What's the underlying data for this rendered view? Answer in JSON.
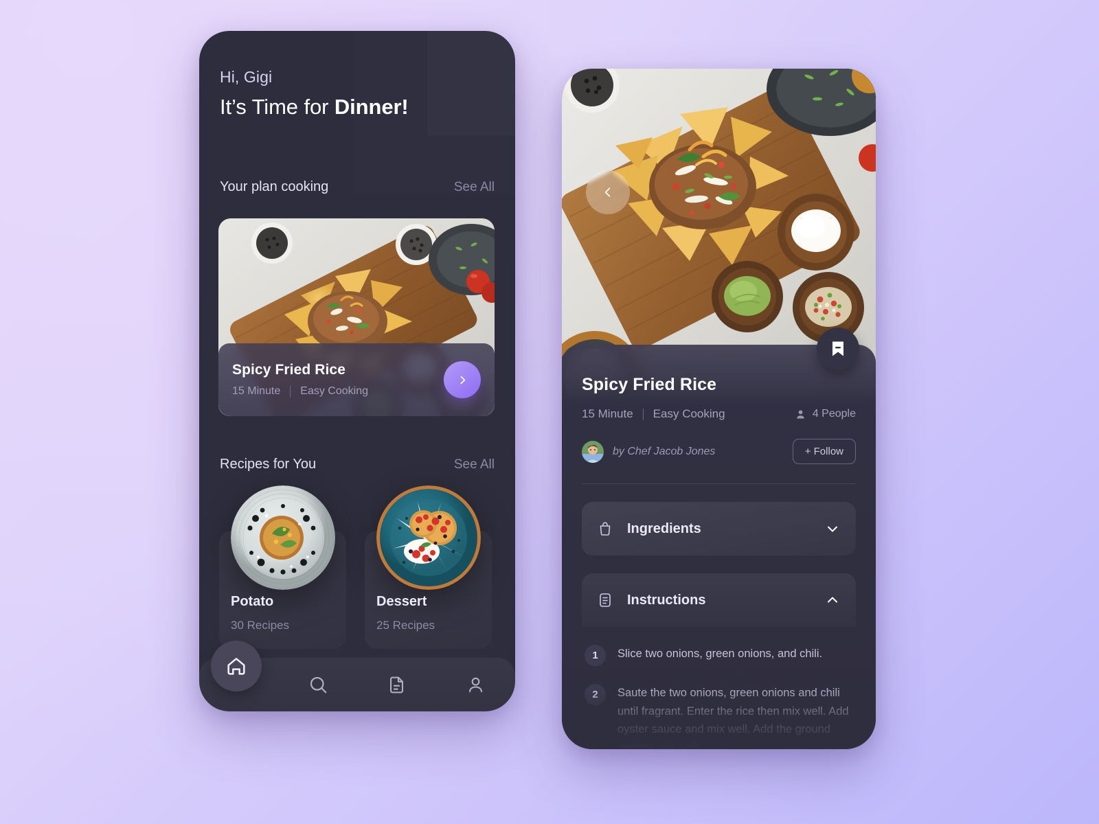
{
  "theme": {
    "bg_light": "#e3d5fa",
    "bg_deep": "#bcb7fb",
    "panel": "#2e2d3d",
    "accent_purple": "#8f6cf2",
    "accent_purple_light": "#b39af8",
    "text_primary": "#ffffff",
    "text_muted": "#8e89a3"
  },
  "home": {
    "greeting": "Hi, Gigi",
    "headline_prefix": "It’s Time for ",
    "headline_bold": "Dinner!",
    "plan_section": {
      "title": "Your plan cooking",
      "see_all": "See All"
    },
    "plan_card": {
      "name": "Spicy Fried Rice",
      "time": "15 Minute",
      "difficulty": "Easy Cooking",
      "go_icon": "chevron-right-icon"
    },
    "recipes_section": {
      "title": "Recipes for You",
      "see_all": "See All"
    },
    "recipes": [
      {
        "title": "Potato",
        "count": "30 Recipes"
      },
      {
        "title": "Dessert",
        "count": "25 Recipes"
      }
    ],
    "nav": [
      {
        "icon": "home-icon",
        "label": "Home",
        "active": true
      },
      {
        "icon": "search-icon",
        "label": "Search",
        "active": false
      },
      {
        "icon": "document-icon",
        "label": "Recipes",
        "active": false
      },
      {
        "icon": "profile-icon",
        "label": "Profile",
        "active": false
      }
    ]
  },
  "detail": {
    "back_icon": "chevron-left-icon",
    "bookmark_icon": "bookmark-icon",
    "title": "Spicy Fried Rice",
    "time": "15 Minute",
    "difficulty": "Easy Cooking",
    "servings": "4 People",
    "servings_icon": "person-icon",
    "author": "by Chef Jacob Jones",
    "follow_label": "+ Follow",
    "sections": [
      {
        "label": "Ingredients",
        "icon": "bag-icon",
        "chevron": "chevron-down-icon",
        "expanded": false
      },
      {
        "label": "Instructions",
        "icon": "document-icon",
        "chevron": "chevron-up-icon",
        "expanded": true
      }
    ],
    "steps": [
      {
        "num": "1",
        "text": "Slice two onions, green onions, and  chili."
      },
      {
        "num": "2",
        "text": "Saute the two onions, green onions and chili until fragrant. Enter the rice then mix well. Add oyster sauce and mix well. Add the ground pepper, mix well."
      }
    ]
  }
}
